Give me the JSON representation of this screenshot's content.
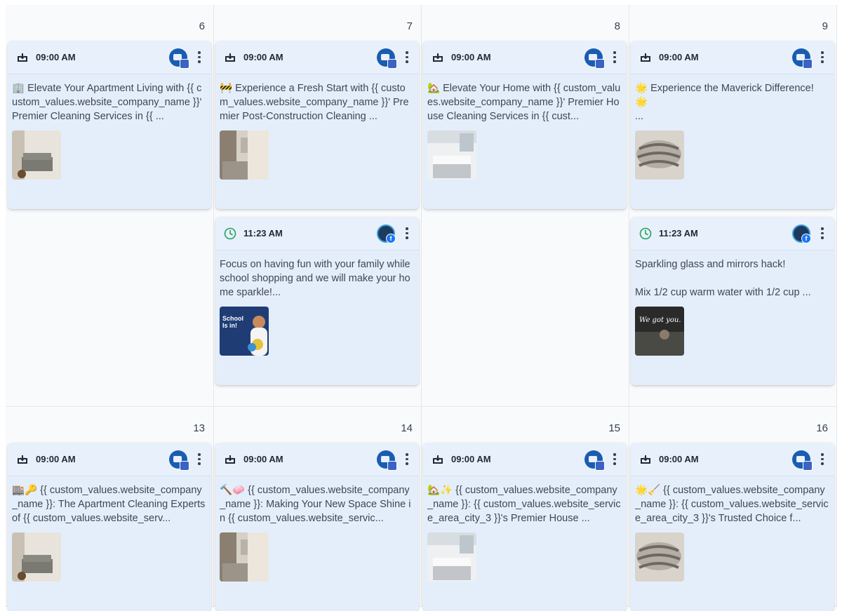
{
  "days": {
    "d6": "6",
    "d7": "7",
    "d8": "8",
    "d9": "9",
    "d13": "13",
    "d14": "14",
    "d15": "15",
    "d16": "16"
  },
  "posts": {
    "p6a": {
      "time": "09:00 AM",
      "text": "🏢 Elevate Your Apartment Living with {{ custom_values.website_company_name }}' Premier Cleaning Services in {{ ...",
      "thumb": "living-room-photo"
    },
    "p7a": {
      "time": "09:00 AM",
      "text": "🚧 Experience a Fresh Start with {{ custom_values.website_company_name }}' Premier Post-Construction Cleaning ...",
      "thumb": "kitchen-photo"
    },
    "p7b": {
      "time": "11:23 AM",
      "text": "Focus on having fun with your family while school shopping and we will make your home sparkle!...",
      "thumb": "school-is-in-graphic",
      "thumb_text": "School Is in!"
    },
    "p8a": {
      "time": "09:00 AM",
      "text": "🏡 Elevate Your Home with {{ custom_values.website_company_name }}' Premier House Cleaning Services in {{ cust...",
      "thumb": "white-kitchen-photo"
    },
    "p9a": {
      "time": "09:00 AM",
      "text": "🌟 Experience the Maverick Difference! 🌟\n...",
      "thumb": "pillow-photo"
    },
    "p9b": {
      "time": "11:23 AM",
      "text": "Sparkling glass and mirrors hack!\n\nMix 1/2 cup warm water with 1/2 cup ...",
      "thumb": "we-got-you-graphic",
      "thumb_text": "We got you."
    },
    "p13a": {
      "time": "09:00 AM",
      "text": "🏬🔑 {{ custom_values.website_company_name }}: The Apartment Cleaning Experts of {{ custom_values.website_serv...",
      "thumb": "living-room-photo"
    },
    "p14a": {
      "time": "09:00 AM",
      "text": "🔨🧼 {{ custom_values.website_company_name }}: Making Your New Space Shine in {{ custom_values.website_servic...",
      "thumb": "kitchen-photo"
    },
    "p15a": {
      "time": "09:00 AM",
      "text": "🏡✨ {{ custom_values.website_company_name }}: {{ custom_values.website_service_area_city_3 }}'s Premier House ...",
      "thumb": "white-kitchen-photo"
    },
    "p16a": {
      "time": "09:00 AM",
      "text": "🌟🧹 {{ custom_values.website_company_name }}: {{ custom_values.website_service_area_city_3 }}'s Trusted Choice f...",
      "thumb": "pillow-photo"
    }
  },
  "colors": {
    "card_bg": "#e4eefb",
    "published_icon": "#1f2937",
    "scheduled_icon": "#22a35a",
    "google_blue": "#1a5db0",
    "facebook_blue": "#1877f2"
  },
  "icons": {
    "published": "upload-tray-icon",
    "scheduled": "clock-icon",
    "menu": "kebab-menu-icon"
  }
}
